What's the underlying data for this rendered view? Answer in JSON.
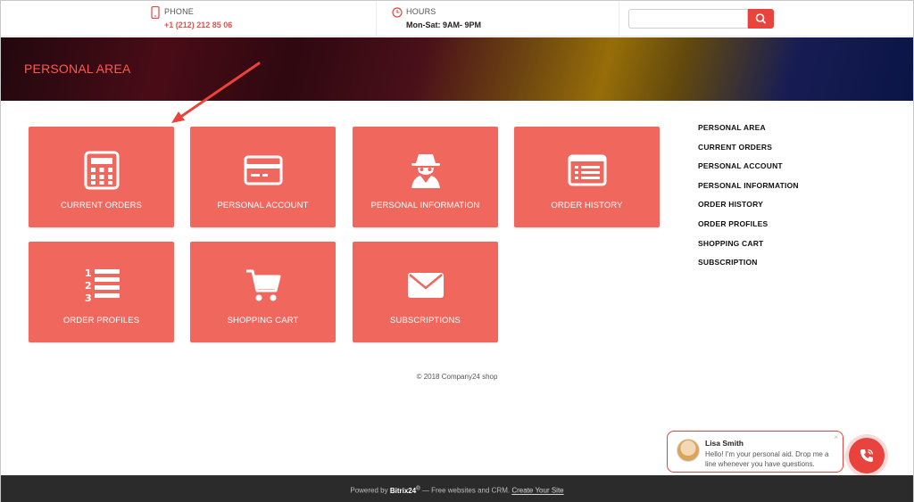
{
  "header": {
    "phone_label": "PHONE",
    "phone_value": "+1 (212) 212 85 06",
    "hours_label": "HOURS",
    "hours_value": "Mon-Sat: 9AM- 9PM",
    "search_placeholder": ""
  },
  "banner": {
    "title": "PERSONAL AREA"
  },
  "tiles": [
    {
      "label": "CURRENT ORDERS",
      "icon": "calculator-icon"
    },
    {
      "label": "PERSONAL ACCOUNT",
      "icon": "credit-card-icon"
    },
    {
      "label": "PERSONAL INFORMATION",
      "icon": "spy-icon"
    },
    {
      "label": "ORDER HISTORY",
      "icon": "list-icon"
    },
    {
      "label": "ORDER PROFILES",
      "icon": "numbered-list-icon"
    },
    {
      "label": "SHOPPING CART",
      "icon": "cart-icon"
    },
    {
      "label": "SUBSCRIPTIONS",
      "icon": "envelope-icon"
    }
  ],
  "side_menu": [
    "PERSONAL AREA",
    "CURRENT ORDERS",
    "PERSONAL ACCOUNT",
    "PERSONAL INFORMATION",
    "ORDER HISTORY",
    "ORDER PROFILES",
    "SHOPPING CART",
    "SUBSCRIPTION"
  ],
  "copyright": "© 2018 Company24 shop",
  "chat": {
    "name": "Lisa Smith",
    "message": "Hello! I'm your personal aid. Drop me a line whenever you have questions.",
    "close": "×"
  },
  "footer": {
    "powered": "Powered by",
    "brand": "Bitrix24",
    "brand_sup": "®",
    "tagline": "— Free websites and CRM.",
    "link": "Create Your Site"
  },
  "colors": {
    "accent": "#e8433c",
    "tile": "#f0675e",
    "footer": "#2b2b2b"
  }
}
